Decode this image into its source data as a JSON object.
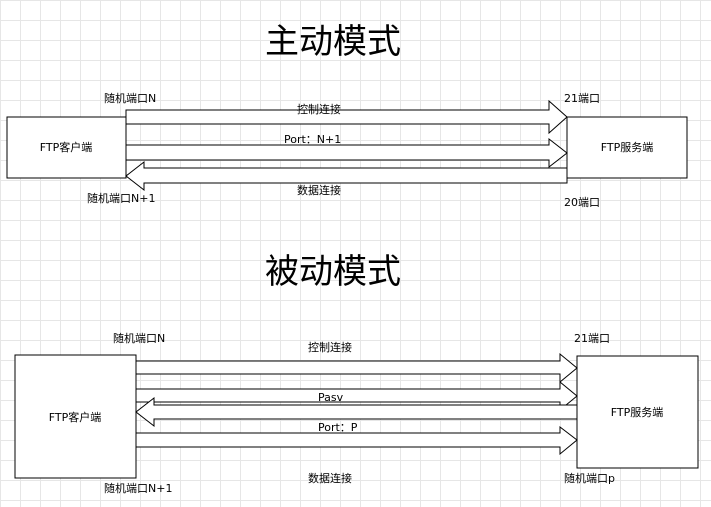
{
  "active_mode": {
    "title": "主动模式",
    "client": "FTP客户端",
    "server": "FTP服务端",
    "client_port_top": "随机端口N",
    "client_port_bottom": "随机端口N+1",
    "server_port_top": "21端口",
    "server_port_bottom": "20端口",
    "control_connection": "控制连接",
    "port_command": "Port：N+1",
    "data_connection": "数据连接"
  },
  "passive_mode": {
    "title": "被动模式",
    "client": "FTP客户端",
    "server": "FTP服务端",
    "client_port_top": "随机端口N",
    "client_port_bottom": "随机端口N+1",
    "server_port_top": "21端口",
    "server_port_bottom": "随机端口p",
    "control_connection": "控制连接",
    "pasv_command": "Pasv",
    "port_command": "Port：P",
    "data_connection": "数据连接"
  }
}
